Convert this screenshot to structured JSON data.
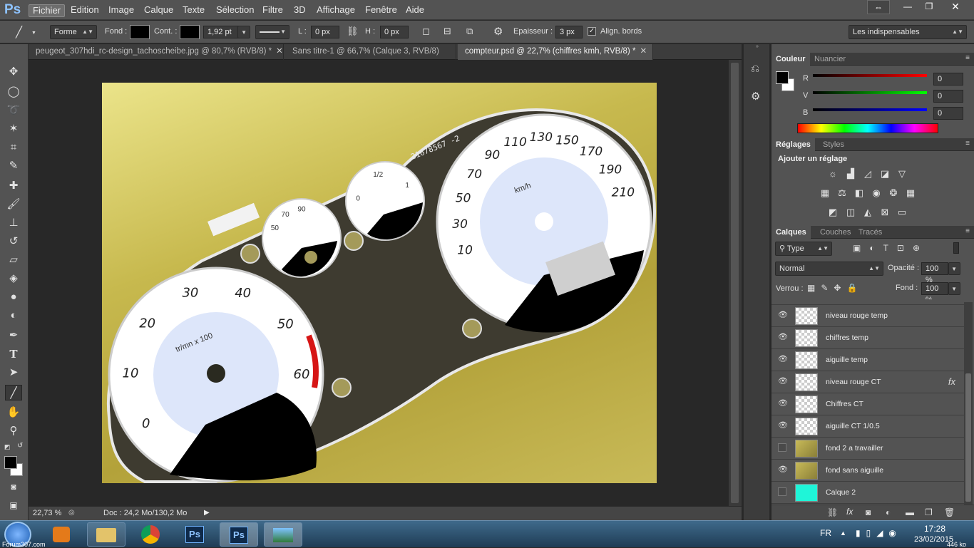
{
  "app": {
    "logo": "Ps"
  },
  "menu": {
    "items": [
      "Fichier",
      "Edition",
      "Image",
      "Calque",
      "Texte",
      "Sélection",
      "Filtre",
      "3D",
      "Affichage",
      "Fenêtre",
      "Aide"
    ],
    "active": "Fichier"
  },
  "options": {
    "shape_mode": "Forme",
    "fill_label": "Fond :",
    "stroke_label": "Cont. :",
    "stroke_width": "1,92 pt",
    "l_label": "L :",
    "l_value": "0 px",
    "h_label": "H :",
    "h_value": "0 px",
    "weight_label": "Epaisseur :",
    "weight_value": "3 px",
    "align_label": "Align. bords",
    "workspace": "Les indispensables"
  },
  "tabs": [
    {
      "label": "peugeot_307hdi_rc-design_tachoscheibe.jpg @ 80,7% (RVB/8) *"
    },
    {
      "label": "Sans titre-1 @ 66,7% (Calque 3, RVB/8) *"
    },
    {
      "label": "compteur.psd @ 22,7% (chiffres kmh, RVB/8) *"
    }
  ],
  "status": {
    "zoom": "22,73 %",
    "doc": "Doc : 24,2 Mo/130,2 Mo"
  },
  "color_panel": {
    "tabs": [
      "Couleur",
      "Nuancier"
    ],
    "r_label": "R",
    "r_value": "0",
    "v_label": "V",
    "v_value": "0",
    "b_label": "B",
    "b_value": "0"
  },
  "adjust_panel": {
    "tabs": [
      "Réglages",
      "Styles"
    ],
    "heading": "Ajouter un réglage"
  },
  "layers_panel": {
    "tabs": [
      "Calques",
      "Couches",
      "Tracés"
    ],
    "filter": "Type",
    "blend_mode": "Normal",
    "opacity_label": "Opacité :",
    "opacity_value": "100 %",
    "lock_label": "Verrou :",
    "fill_label": "Fond :",
    "fill_value": "100 %",
    "layers": [
      {
        "name": "niveau rouge temp",
        "visible": true,
        "fx": false,
        "thumb": "transparent"
      },
      {
        "name": "chiffres temp",
        "visible": true,
        "fx": false,
        "thumb": "transparent"
      },
      {
        "name": "aiguille temp",
        "visible": true,
        "fx": false,
        "thumb": "transparent"
      },
      {
        "name": "niveau rouge CT",
        "visible": true,
        "fx": true,
        "thumb": "transparent"
      },
      {
        "name": "Chiffres CT",
        "visible": true,
        "fx": false,
        "thumb": "transparent"
      },
      {
        "name": "aiguille CT 1/0.5",
        "visible": true,
        "fx": false,
        "thumb": "transparent"
      },
      {
        "name": "fond 2 a travailler",
        "visible": false,
        "fx": false,
        "thumb": "image"
      },
      {
        "name": "fond sans aiguille",
        "visible": true,
        "fx": false,
        "thumb": "image"
      },
      {
        "name": "Calque 2",
        "visible": false,
        "fx": false,
        "thumb": "cyan"
      }
    ],
    "fx_text": "fx"
  },
  "gauges": {
    "serial": "21678567 -2",
    "kmh_unit": "km/h",
    "kmh_labels": [
      "10",
      "30",
      "50",
      "70",
      "90",
      "110",
      "130",
      "150",
      "170",
      "190",
      "210"
    ],
    "rpm_unit": "tr/mn x 100",
    "rpm_labels": [
      "0",
      "10",
      "20",
      "30",
      "40",
      "50",
      "60"
    ],
    "temp_labels": [
      "50",
      "70",
      "90"
    ],
    "fuel_labels": [
      "0",
      "1/2",
      "1"
    ]
  },
  "taskbar": {
    "lang": "FR",
    "time": "17:28",
    "date": "23/02/2015",
    "watermark": "Forum307.com",
    "size_badge": "446 ko"
  },
  "colors": {
    "accent_blue": "#8ec3ff",
    "gauge_face": "#dde6fa",
    "cyan_layer": "#1ff5d8",
    "red_zone": "#d61515"
  }
}
